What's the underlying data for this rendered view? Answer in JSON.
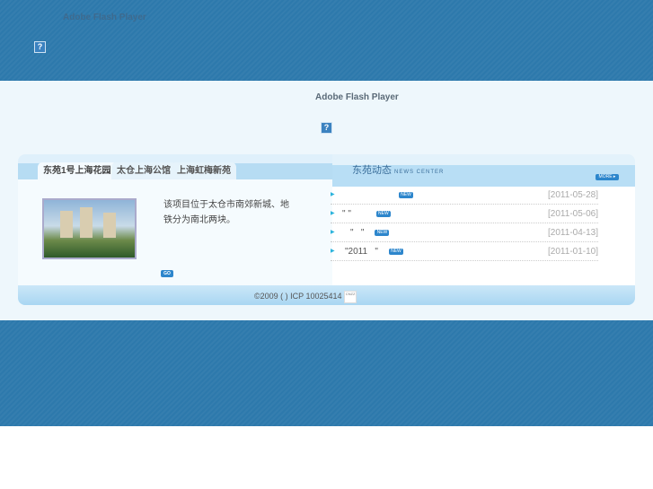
{
  "top_banner": {
    "plugin_text": "Adobe Flash Player",
    "icon": "question-icon"
  },
  "mid_banner": {
    "plugin_text": "Adobe Flash Player",
    "icon": "question-icon"
  },
  "tabs": [
    {
      "label": "东苑1号上海花园"
    },
    {
      "label": "太仓上海公馆"
    },
    {
      "label": "上海虹梅新苑"
    }
  ],
  "project": {
    "description": "该项目位于太仓市南郊新城、地铁分为南北两块。",
    "go_label": "GO"
  },
  "news": {
    "title": "东苑动态",
    "subtitle": "NEWS CENTER",
    "more_label": "MORE ▸",
    "new_badge": "NEW",
    "items": [
      {
        "title": "",
        "date": "[2011-05-28]"
      },
      {
        "title": "\" \"",
        "date": "[2011-05-06]"
      },
      {
        "title": "\"   \"",
        "date": "[2011-04-13]"
      },
      {
        "title": "\"2011   \"",
        "date": "[2011-01-10]"
      }
    ]
  },
  "footer": {
    "copyright": "©2009      ( )    ICP 10025414",
    "stats_badge": "CNZZ"
  },
  "colors": {
    "banner_blue": "#2d79ac",
    "accent": "#2d86cc"
  }
}
